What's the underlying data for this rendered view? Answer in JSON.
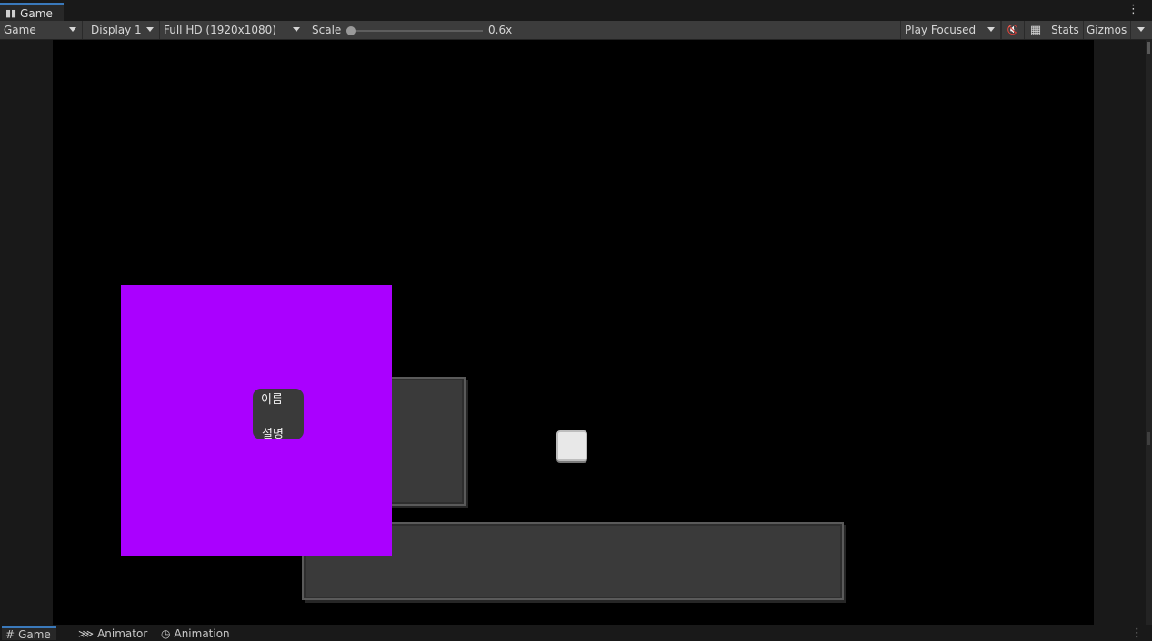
{
  "tab": {
    "label": "Game",
    "icon": "gamepad-icon"
  },
  "toolbar": {
    "view_mode": "Game",
    "display": "Display 1",
    "resolution": "Full HD (1920x1080)",
    "scale_label": "Scale",
    "scale_value": "0.6x",
    "scale_fraction": 0.0,
    "play_mode": "Play Focused",
    "mute_icon": "mute-audio-icon",
    "shortcuts_icon": "keyboard-shortcuts-icon",
    "stats_label": "Stats",
    "gizmos_label": "Gizmos"
  },
  "scene": {
    "tooltip_name": "이름",
    "tooltip_desc": "설명",
    "panel_color": "#aa00ff"
  },
  "bottom_tabs": [
    "Game",
    "Animator",
    "Animation"
  ]
}
